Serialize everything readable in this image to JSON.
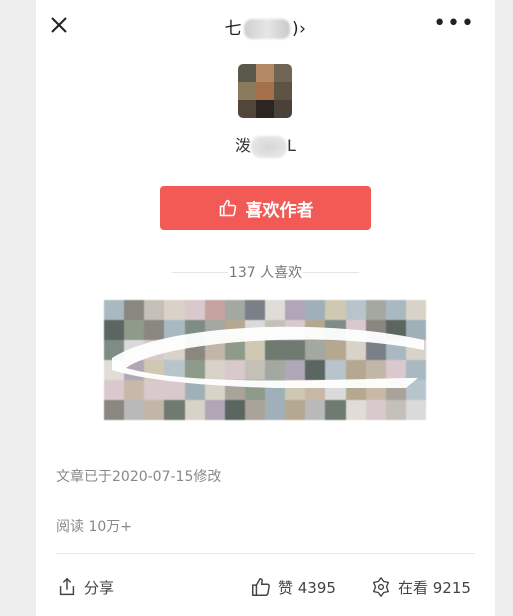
{
  "header": {
    "title_prefix": "七",
    "title_suffix": ")",
    "chevron": "›",
    "more": "•••"
  },
  "author": {
    "name_prefix": "泼",
    "name_suffix": "L"
  },
  "like_button": {
    "label": "喜欢作者",
    "icon": "thumbs-up-icon"
  },
  "likes": {
    "label": "137 人喜欢"
  },
  "footer": {
    "modified": "文章已于2020-07-15修改",
    "reads": "阅读 10万+",
    "share_label": "分享",
    "like_label": "赞 4395",
    "watching_label": "在看 9215"
  },
  "colors": {
    "accent": "#f25a56",
    "background": "#ededed"
  }
}
